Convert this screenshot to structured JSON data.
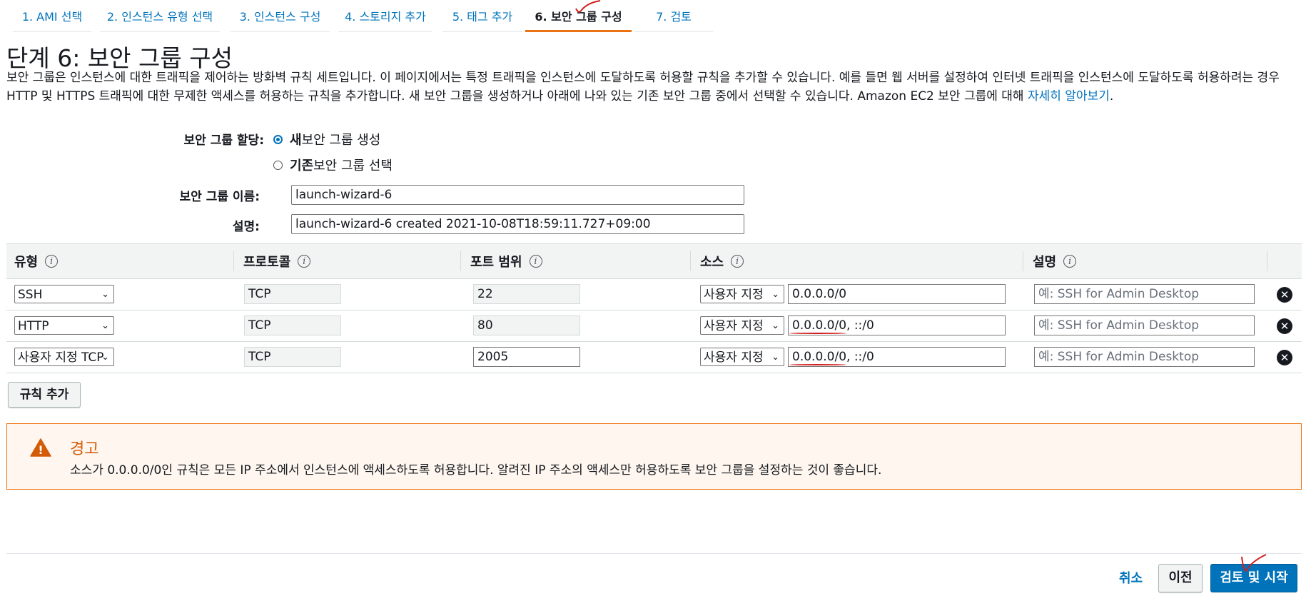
{
  "tabs": [
    {
      "label": "1. AMI 선택"
    },
    {
      "label": "2. 인스턴스 유형 선택"
    },
    {
      "label": "3. 인스턴스 구성"
    },
    {
      "label": "4. 스토리지 추가"
    },
    {
      "label": "5. 태그 추가"
    },
    {
      "label": "6. 보안 그룹 구성",
      "active": true
    },
    {
      "label": "7. 검토"
    }
  ],
  "page": {
    "title": "단계 6: 보안 그룹 구성",
    "intro": "보안 그룹은 인스턴스에 대한 트래픽을 제어하는 방화벽 규칙 세트입니다. 이 페이지에서는 특정 트래픽을 인스턴스에 도달하도록 허용할 규칙을 추가할 수 있습니다. 예를 들면 웹 서버를 설정하여 인터넷 트래픽을 인스턴스에 도달하도록 허용하려는 경우 HTTP 및 HTTPS 트래픽에 대한 무제한 액세스를 허용하는 규칙을 추가합니다. 새 보안 그룹을 생성하거나 아래에 나와 있는 기존 보안 그룹 중에서 선택할 수 있습니다. Amazon EC2 보안 그룹에 대해 ",
    "learn_more": "자세히 알아보기",
    "intro_end": "."
  },
  "form": {
    "assign_label": "보안 그룹 할당:",
    "radio_new_bold": "새",
    "radio_new_rest": " 보안 그룹 생성",
    "radio_existing_bold": "기존",
    "radio_existing_rest": " 보안 그룹 선택",
    "name_label": "보안 그룹 이름:",
    "name_value": "launch-wizard-6",
    "desc_label": "설명:",
    "desc_value": "launch-wizard-6 created 2021-10-08T18:59:11.727+09:00"
  },
  "table": {
    "headers": {
      "type": "유형",
      "protocol": "프로토콜",
      "port": "포트 범위",
      "source": "소스",
      "description": "설명"
    },
    "info_glyph": "i",
    "delete_glyph": "✕",
    "rows": [
      {
        "type": "SSH",
        "protocol": "TCP",
        "port": "22",
        "source_mode": "사용자 지정",
        "source": "0.0.0.0/0",
        "desc_placeholder": "예: SSH for Admin Desktop"
      },
      {
        "type": "HTTP",
        "protocol": "TCP",
        "port": "80",
        "source_mode": "사용자 지정",
        "source": "0.0.0.0/0, ::/0",
        "desc_placeholder": "예: SSH for Admin Desktop"
      },
      {
        "type": "사용자 지정 TCP",
        "protocol": "TCP",
        "port": "2005",
        "source_mode": "사용자 지정",
        "source": "0.0.0.0/0, ::/0",
        "desc_placeholder": "예: SSH for Admin Desktop"
      }
    ]
  },
  "buttons": {
    "add_rule": "규칙 추가",
    "cancel": "취소",
    "previous": "이전",
    "review_launch": "검토 및 시작"
  },
  "warning": {
    "title": "경고",
    "text": "소스가 0.0.0.0/0인 규칙은 모든 IP 주소에서 인스턴스에 액세스하도록 허용합니다. 알려진 IP 주소의 액세스만 허용하도록 보안 그룹을 설정하는 것이 좋습니다.",
    "icon_glyph": "!"
  },
  "icons": {
    "chevron": "⌄"
  },
  "colors": {
    "link": "#0073bb",
    "accent_orange": "#ec7211",
    "annotation_red": "#d21f1f"
  }
}
